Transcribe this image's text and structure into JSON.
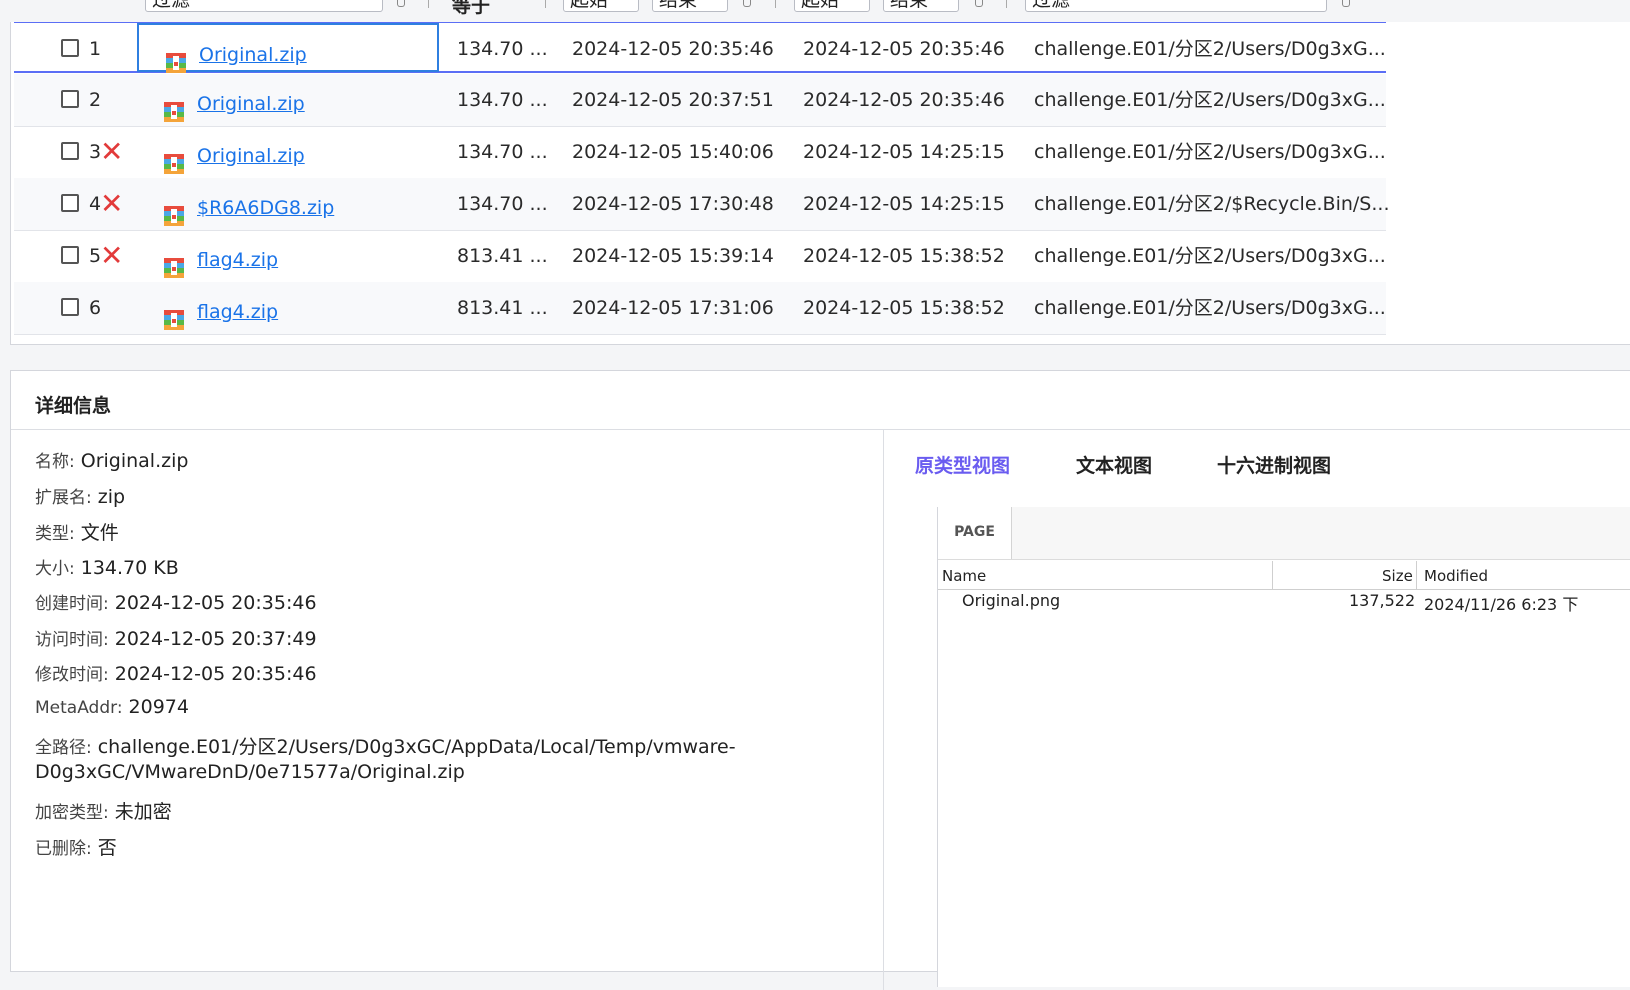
{
  "filters": {
    "filter_placeholder": "过滤",
    "sort_label": "等于",
    "start_label": "起始",
    "end_label": "结束"
  },
  "rows": [
    {
      "index": "1",
      "deleted": false,
      "name": "Original.zip",
      "size": "134.70 ...",
      "time1": "2024-12-05 20:35:46",
      "time2": "2024-12-05 20:35:46",
      "path": "challenge.E01/分区2/Users/D0g3xG..."
    },
    {
      "index": "2",
      "deleted": false,
      "name": "Original.zip",
      "size": "134.70 ...",
      "time1": "2024-12-05 20:37:51",
      "time2": "2024-12-05 20:35:46",
      "path": "challenge.E01/分区2/Users/D0g3xG..."
    },
    {
      "index": "3",
      "deleted": true,
      "name": "Original.zip",
      "size": "134.70 ...",
      "time1": "2024-12-05 15:40:06",
      "time2": "2024-12-05 14:25:15",
      "path": "challenge.E01/分区2/Users/D0g3xG..."
    },
    {
      "index": "4",
      "deleted": true,
      "name": "$R6A6DG8.zip",
      "size": "134.70 ...",
      "time1": "2024-12-05 17:30:48",
      "time2": "2024-12-05 14:25:15",
      "path": "challenge.E01/分区2/$Recycle.Bin/S..."
    },
    {
      "index": "5",
      "deleted": true,
      "name": "flag4.zip",
      "size": "813.41 ...",
      "time1": "2024-12-05 15:39:14",
      "time2": "2024-12-05 15:38:52",
      "path": "challenge.E01/分区2/Users/D0g3xG..."
    },
    {
      "index": "6",
      "deleted": false,
      "name": "flag4.zip",
      "size": "813.41 ...",
      "time1": "2024-12-05 17:31:06",
      "time2": "2024-12-05 15:38:52",
      "path": "challenge.E01/分区2/Users/D0g3xG..."
    }
  ],
  "deleted_mark": "✕",
  "details": {
    "title": "详细信息",
    "name_label": "名称:",
    "name": "Original.zip",
    "ext_label": "扩展名:",
    "ext": "zip",
    "type_label": "类型:",
    "type": "文件",
    "size_label": "大小:",
    "size": "134.70 KB",
    "created_label": "创建时间:",
    "created": "2024-12-05 20:35:46",
    "accessed_label": "访问时间:",
    "accessed": "2024-12-05 20:37:49",
    "modified_label": "修改时间:",
    "modified": "2024-12-05 20:35:46",
    "meta_label": "MetaAddr:",
    "meta": "20974",
    "path_label": "全路径:",
    "path_line1": "challenge.E01/分区2/Users/D0g3xGC/AppData/Local/Temp/vmware-",
    "path_line2": "D0g3xGC/VMwareDnD/0e71577a/Original.zip",
    "enc_label": "加密类型:",
    "enc": "未加密",
    "deleted_label": "已删除:",
    "deleted": "否"
  },
  "tabs": [
    "原类型视图",
    "文本视图",
    "十六进制视图"
  ],
  "viewer": {
    "page_tab": "PAGE",
    "col_name": "Name",
    "col_size": "Size",
    "col_modified": "Modified",
    "file_name": "Original.png",
    "file_size": "137,522",
    "file_modified": "2024/11/26 6:23 下"
  },
  "colors": {
    "link": "#1a73e8",
    "deleted": "#e23a3a",
    "active_tab": "#6a5cf0",
    "selection": "#5b6ef5"
  }
}
